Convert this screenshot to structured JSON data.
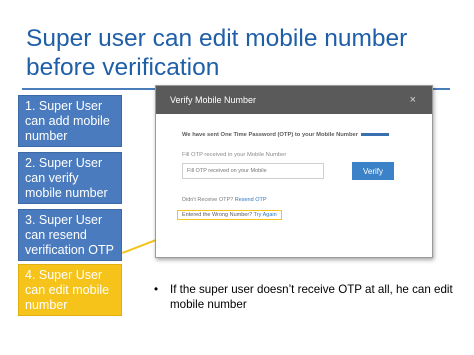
{
  "slide": {
    "title": "Super user can edit mobile number before verification",
    "steps": [
      "1. Super User can add mobile number",
      "2. Super User can verify mobile number",
      "3. Super User can resend verification OTP",
      "4. Super User can edit mobile number"
    ],
    "note": "If the super user doesn’t receive OTP at all, he can edit mobile number",
    "bullet": "•"
  },
  "dialog": {
    "title": "Verify Mobile Number",
    "close_glyph": "×",
    "message": "We have sent One Time Password (OTP) to your Mobile Number",
    "field_label": "Fill OTP received in your Mobile Number",
    "otp_placeholder": "Fill OTP received on your Mobile",
    "verify_label": "Verify",
    "didnt_receive": "Didn't Receive OTP?",
    "resend_label": "Resend OTP",
    "wrong_number": "Entered the Wrong Number?",
    "try_again_label": "Try Again"
  },
  "colors": {
    "title": "#1f5fa8",
    "step_box": "#4a7bbf",
    "step_active": "#f6c31a",
    "dialog_header": "#5a5a5a",
    "verify_button": "#3b82c8",
    "link": "#2f77c4"
  }
}
